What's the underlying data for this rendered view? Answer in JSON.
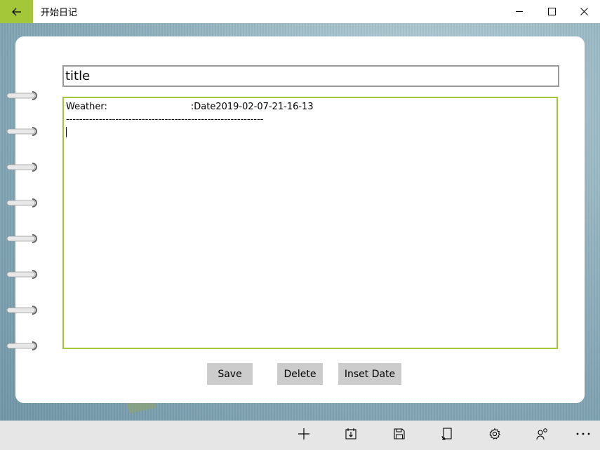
{
  "window": {
    "title": "开始日记",
    "accent": "#a4c639"
  },
  "editor": {
    "title_value": "title",
    "weather_label": "Weather:",
    "date_text": ":Date2019-02-07-21-16-13",
    "separator": "------------------------------------------------------------"
  },
  "buttons": {
    "save": "Save",
    "delete": "Delete",
    "insert_date": "Inset Date"
  },
  "appbar": {
    "icons": [
      "add-icon",
      "calendar-import-icon",
      "save-icon",
      "rotate-page-icon",
      "settings-icon",
      "people-icon",
      "more-icon"
    ]
  }
}
